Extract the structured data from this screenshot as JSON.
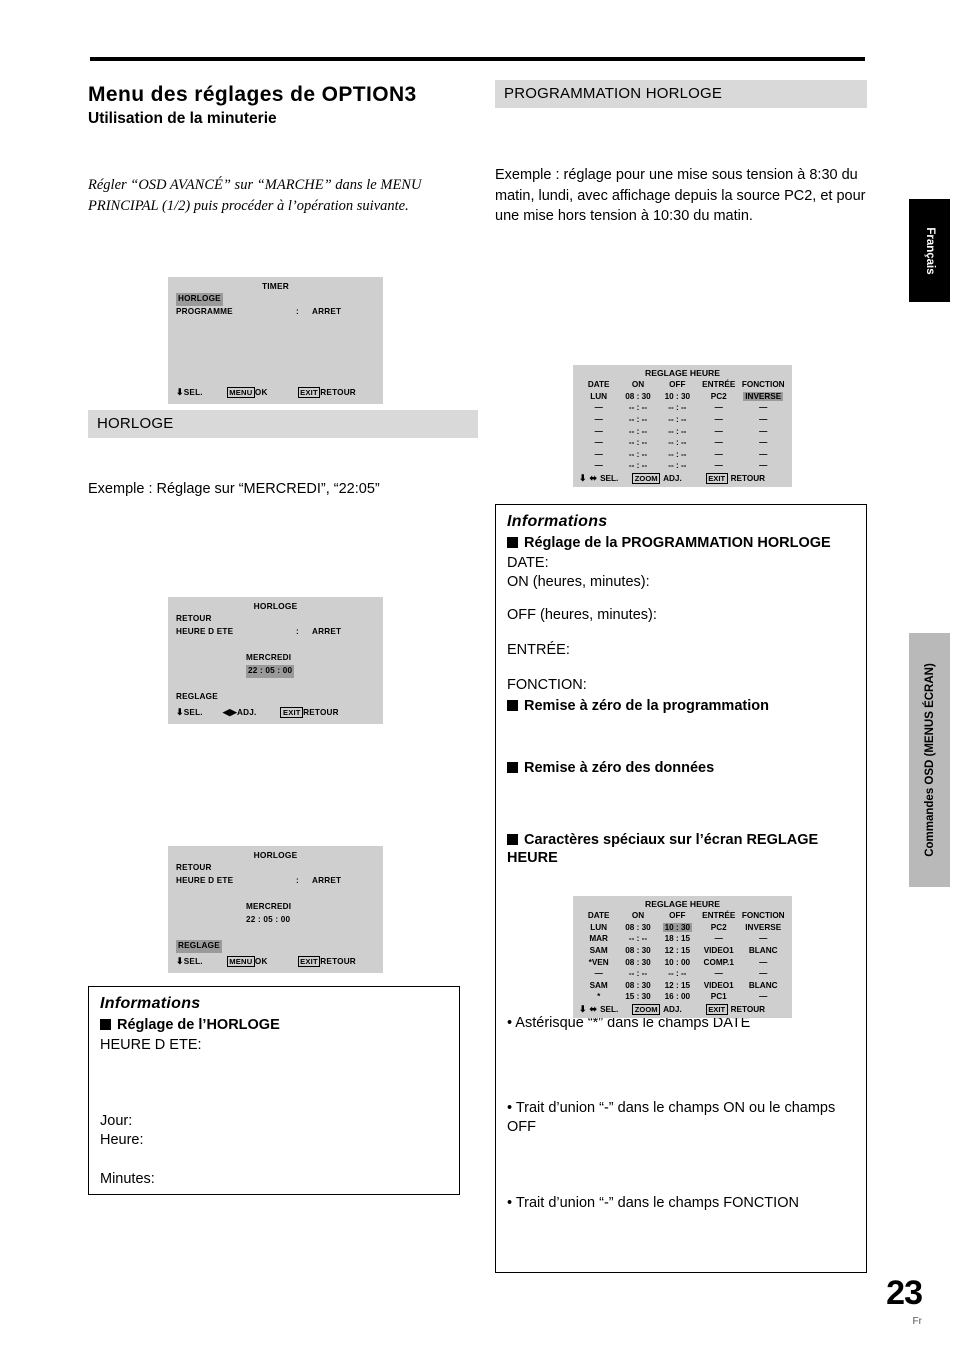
{
  "page": {
    "number": "23",
    "lang_code": "Fr"
  },
  "side_tabs": {
    "language": "Français",
    "section": "Commandes OSD (MENUS ÉCRAN)"
  },
  "left": {
    "title": "Menu des réglages de OPTION3",
    "subtitle": "Utilisation de la minuterie",
    "italic_note": "Régler “OSD AVANCÉ” sur “MARCHE” dans le MENU PRINCIPAL (1/2) puis procéder à l’opération suivante.",
    "section_bar": "HORLOGE",
    "example": "Exemple : Réglage sur “MERCREDI”, “22:05”",
    "timer_panel": {
      "title": "TIMER",
      "item1": "HORLOGE",
      "item2_label": "PROGRAMME",
      "item2_colon": ":",
      "item2_value": "ARRET",
      "foot_sel": "SEL.",
      "foot_menu_key": "MENU",
      "foot_ok": "OK",
      "foot_exit_key": "EXIT",
      "foot_retour": "RETOUR"
    },
    "horloge_panel_1": {
      "title": "HORLOGE",
      "item1": "RETOUR",
      "item2_label": "HEURE D ETE",
      "item2_colon": ":",
      "item2_value": "ARRET",
      "day": "MERCREDI",
      "time": "22 : 05 : 00",
      "reglage": "REGLAGE",
      "foot_sel": "SEL.",
      "foot_adj": "ADJ.",
      "foot_exit_key": "EXIT",
      "foot_retour": "RETOUR"
    },
    "horloge_panel_2": {
      "title": "HORLOGE",
      "item1": "RETOUR",
      "item2_label": "HEURE D ETE",
      "item2_colon": ":",
      "item2_value": "ARRET",
      "day": "MERCREDI",
      "time": "22 : 05 : 00",
      "reglage": "REGLAGE",
      "foot_sel": "SEL.",
      "foot_menu_key": "MENU",
      "foot_ok": "OK",
      "foot_exit_key": "EXIT",
      "foot_retour": "RETOUR"
    },
    "info": {
      "heading": "Informations",
      "item1": "Réglage de l’HORLOGE",
      "line1": "HEURE D ETE:",
      "line2": "Jour:",
      "line3": "Heure:",
      "line4": "Minutes:"
    }
  },
  "right": {
    "section_bar": "PROGRAMMATION HORLOGE",
    "intro": "Exemple : réglage pour une mise sous tension à 8:30 du matin, lundi, avec affichage depuis la source PC2, et pour une mise hors tension à 10:30 du matin.",
    "table1": {
      "title": "REGLAGE HEURE",
      "headers": [
        "DATE",
        "ON",
        "OFF",
        "ENTRÉE",
        "FONCTION"
      ],
      "rows": [
        {
          "date": "LUN",
          "on": "08 : 30",
          "off": "10 : 30",
          "entree": "PC2",
          "fonction": "INVERSE",
          "hl": "fonction"
        },
        {
          "date": "—",
          "on": "-- : --",
          "off": "-- : --",
          "entree": "—",
          "fonction": "—"
        },
        {
          "date": "—",
          "on": "-- : --",
          "off": "-- : --",
          "entree": "—",
          "fonction": "—"
        },
        {
          "date": "—",
          "on": "-- : --",
          "off": "-- : --",
          "entree": "—",
          "fonction": "—"
        },
        {
          "date": "—",
          "on": "-- : --",
          "off": "-- : --",
          "entree": "—",
          "fonction": "—"
        },
        {
          "date": "—",
          "on": "-- : --",
          "off": "-- : --",
          "entree": "—",
          "fonction": "—"
        },
        {
          "date": "—",
          "on": "-- : --",
          "off": "-- : --",
          "entree": "—",
          "fonction": "—"
        }
      ],
      "foot_sel": "SEL.",
      "foot_zoom_key": "ZOOM",
      "foot_adj": "ADJ.",
      "foot_exit_key": "EXIT",
      "foot_retour": "RETOUR"
    },
    "table2": {
      "title": "REGLAGE HEURE",
      "headers": [
        "DATE",
        "ON",
        "OFF",
        "ENTRÉE",
        "FONCTION"
      ],
      "rows": [
        {
          "date": "LUN",
          "on": "08 : 30",
          "off": "10 : 30",
          "entree": "PC2",
          "fonction": "INVERSE",
          "hl": "off"
        },
        {
          "date": "MAR",
          "on": "-- : --",
          "off": "18 : 15",
          "entree": "—",
          "fonction": "—"
        },
        {
          "date": "SAM",
          "on": "08 : 30",
          "off": "12 : 15",
          "entree": "VIDEO1",
          "fonction": "BLANC"
        },
        {
          "date": "*VEN",
          "on": "08 : 30",
          "off": "10 : 00",
          "entree": "COMP.1",
          "fonction": "—"
        },
        {
          "date": "—",
          "on": "-- : --",
          "off": "-- : --",
          "entree": "—",
          "fonction": "—"
        },
        {
          "date": "SAM",
          "on": "08 : 30",
          "off": "12 : 15",
          "entree": "VIDEO1",
          "fonction": "BLANC"
        },
        {
          "date": "*",
          "on": "15 : 30",
          "off": "16 : 00",
          "entree": "PC1",
          "fonction": "—"
        }
      ],
      "foot_sel": "SEL.",
      "foot_zoom_key": "ZOOM",
      "foot_adj": "ADJ.",
      "foot_exit_key": "EXIT",
      "foot_retour": "RETOUR"
    },
    "info": {
      "heading": "Informations",
      "item1": "Réglage de la PROGRAMMATION HORLOGE",
      "line_date": "DATE:",
      "line_on": "ON (heures, minutes):",
      "line_off": "OFF  (heures,  minutes):",
      "line_entree": "ENTRÉE:",
      "line_fonction": "FONCTION:",
      "item2": "Remise à zéro de la programmation",
      "item3": "Remise à zéro des données",
      "item4": "Caractères spéciaux sur l’écran REGLAGE HEURE",
      "bullet1": "• Astérisque “*” dans le champs DATE",
      "bullet2": "• Trait d’union “-” dans le champs ON ou le champs OFF",
      "bullet3": "• Trait d’union “-” dans le champs FONCTION"
    }
  },
  "icons": {
    "updown": "⬍",
    "leftright": "⬌"
  }
}
